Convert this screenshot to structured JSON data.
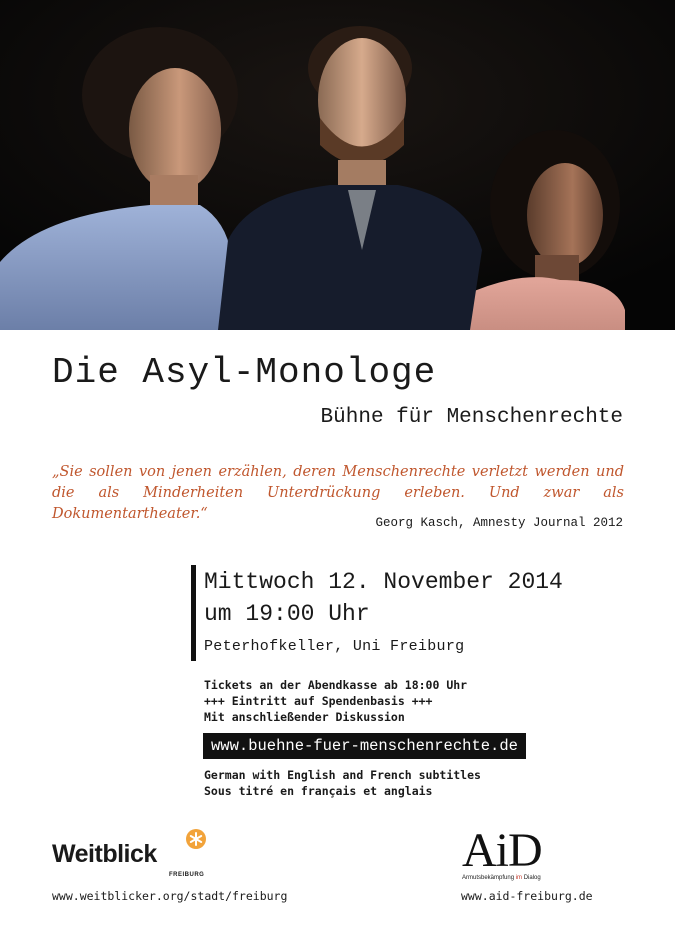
{
  "poster": {
    "title": "Die Asyl-Monologe",
    "subtitle": "Bühne für Menschenrechte"
  },
  "quote": {
    "text": "„Sie sollen von jenen erzählen, deren Menschenrechte verletzt werden und die als Minderheiten Unterdrückung erleben. Und zwar als Dokumentartheater.“",
    "source": "Georg Kasch,  Amnesty Journal 2012",
    "color": "#c0572e"
  },
  "event": {
    "date_line": "Mittwoch 12. November 2014",
    "time_line": "um 19:00 Uhr",
    "venue": "Peterhofkeller, Uni Freiburg"
  },
  "info": {
    "tickets": "Tickets an der Abendkasse ab 18:00 Uhr",
    "entry": "+++ Eintritt auf Spendenbasis +++",
    "discussion": "Mit anschließender Diskussion"
  },
  "website": "www.buehne-fuer-menschenrechte.de",
  "subtitles": {
    "english": "German with English and French subtitles",
    "french": "Sous titré en français et anglais"
  },
  "partners": {
    "weitblick": {
      "logo_text": "Weitblick",
      "logo_sub": "FREIBURG",
      "url": "www.weitblicker.org/stadt/freiburg",
      "accent": "#f2a33a"
    },
    "aid": {
      "logo_text": "AiD",
      "logo_sub_1": "Armutsbekämpfung",
      "logo_sub_2": "im",
      "logo_sub_3": "Dialog",
      "url": "www.aid-freiburg.de"
    }
  }
}
